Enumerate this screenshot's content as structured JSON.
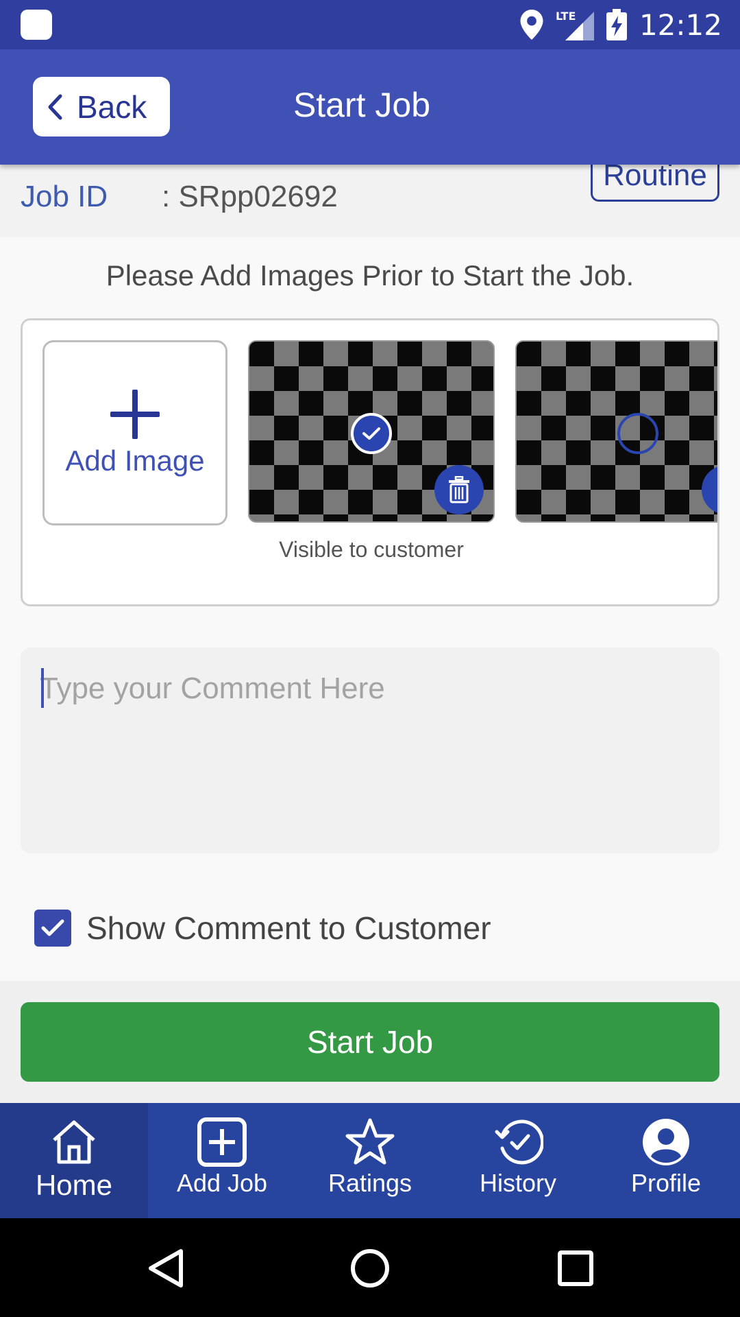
{
  "status_bar": {
    "time": "12:12",
    "network": "LTE"
  },
  "header": {
    "back_label": "Back",
    "title": "Start Job"
  },
  "job": {
    "id_label": "Job ID",
    "id_value": ": SRpp02692",
    "type_badge": "Routine"
  },
  "images_section": {
    "instruction": "Please Add Images Prior to Start the Job.",
    "add_image_label": "Add Image",
    "images": [
      {
        "selected": true,
        "caption": "Visible to customer"
      },
      {
        "selected": false,
        "caption": ""
      }
    ]
  },
  "comment": {
    "placeholder": "Type your Comment Here",
    "value": ""
  },
  "show_comment": {
    "label": "Show Comment to Customer",
    "checked": true
  },
  "primary_action": {
    "label": "Start Job",
    "color": "#339944"
  },
  "bottom_nav": {
    "items": [
      {
        "label": "Home",
        "icon": "home-icon",
        "active": true
      },
      {
        "label": "Add Job",
        "icon": "add-box-icon",
        "active": false
      },
      {
        "label": "Ratings",
        "icon": "star-icon",
        "active": false
      },
      {
        "label": "History",
        "icon": "history-icon",
        "active": false
      },
      {
        "label": "Profile",
        "icon": "profile-icon",
        "active": false
      }
    ]
  },
  "colors": {
    "primary": "#3f51b5",
    "primary_dark": "#303f9f",
    "nav": "#27449f",
    "success": "#339944"
  }
}
